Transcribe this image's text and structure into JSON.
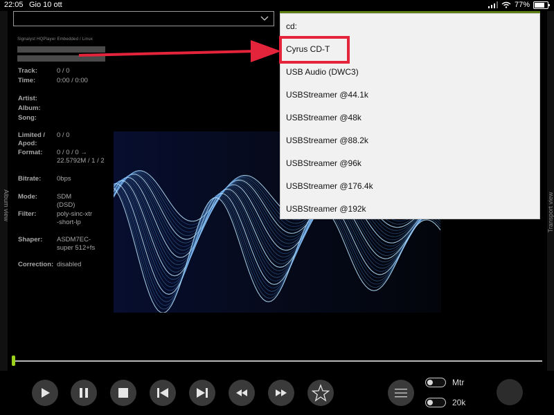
{
  "status_bar": {
    "time": "22:05",
    "date": "Gio 10 ott",
    "battery": "77%",
    "battery_level": 0.77
  },
  "player": {
    "engine": "Signalyst HQPlayer Embedded / Linux",
    "info": [
      {
        "label": "Track:",
        "value": "0 / 0"
      },
      {
        "label": "Time:",
        "value": "0:00 / 0:00"
      },
      {
        "label": "Artist:",
        "value": ""
      },
      {
        "label": "Album:",
        "value": ""
      },
      {
        "label": "Song:",
        "value": ""
      },
      {
        "label": "Limited / Apod:",
        "value": "0 / 0"
      },
      {
        "label": "Format:",
        "value": "0 / 0 / 0 → 22.5792M / 1 / 2"
      },
      {
        "label": "Bitrate:",
        "value": "0bps"
      },
      {
        "label": "Mode:",
        "value": "SDM (DSD)"
      },
      {
        "label": "Filter:",
        "value": "poly-sinc-xtr-short-lp"
      },
      {
        "label": "Shaper:",
        "value": "ASDM7EC-super 512+fs"
      },
      {
        "label": "Correction:",
        "value": "disabled"
      }
    ],
    "album_view_label": "Album view",
    "transport_view_label": "Transport view",
    "progress": 0.0
  },
  "dropdown": {
    "items": [
      "cd:",
      "Cyrus CD-T",
      "USB Audio (DWC3)",
      "USBStreamer @44.1k",
      "USBStreamer @48k",
      "USBStreamer @88.2k",
      "USBStreamer @96k",
      "USBStreamer @176.4k",
      "USBStreamer @192k"
    ],
    "highlighted": "Cyrus CD-T"
  },
  "controls": {
    "buttons": [
      "play-icon",
      "pause-icon",
      "stop-icon",
      "previous-icon",
      "next-icon",
      "rewind-icon",
      "fast-forward-icon",
      "star-icon",
      "menu-icon"
    ],
    "toggles": [
      {
        "label": "Mtr",
        "on": false
      },
      {
        "label": "20k",
        "on": false
      }
    ]
  },
  "colors": {
    "accent_green": "#9bd21b",
    "highlight_red": "#e3243b",
    "button_gray": "#3a3a3a"
  }
}
